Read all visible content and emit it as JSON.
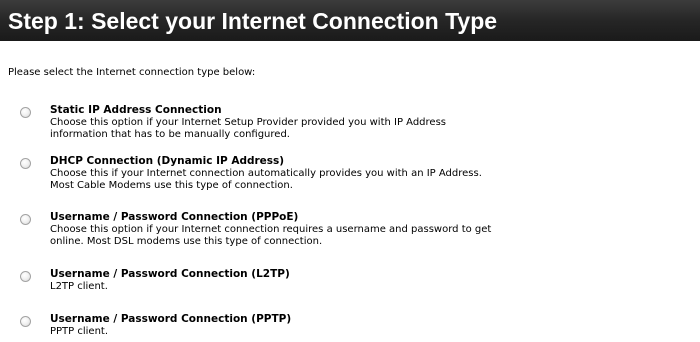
{
  "header": {
    "title": "Step 1: Select your Internet Connection Type"
  },
  "intro_text": "Please select the Internet connection type below:",
  "options": [
    {
      "title": "Static IP Address Connection",
      "desc_lines": [
        "Choose this option if your Internet Setup Provider provided you with IP Address",
        "information that has to be manually configured."
      ],
      "selected": false
    },
    {
      "title": "DHCP Connection (Dynamic IP Address)",
      "desc_lines": [
        "Choose this if your Internet connection automatically provides you with an IP Address.",
        "Most Cable Modems use this type of connection."
      ],
      "selected": false
    },
    {
      "title": "Username / Password Connection (PPPoE)",
      "desc_lines": [
        "Choose this option if your Internet connection requires a username and password to get",
        "online. Most DSL modems use this type of connection."
      ],
      "selected": false
    },
    {
      "title": "Username / Password Connection (L2TP)",
      "desc_lines": [
        "L2TP client."
      ],
      "selected": false
    },
    {
      "title": "Username / Password Connection (PPTP)",
      "desc_lines": [
        "PPTP client."
      ],
      "selected": false
    }
  ]
}
